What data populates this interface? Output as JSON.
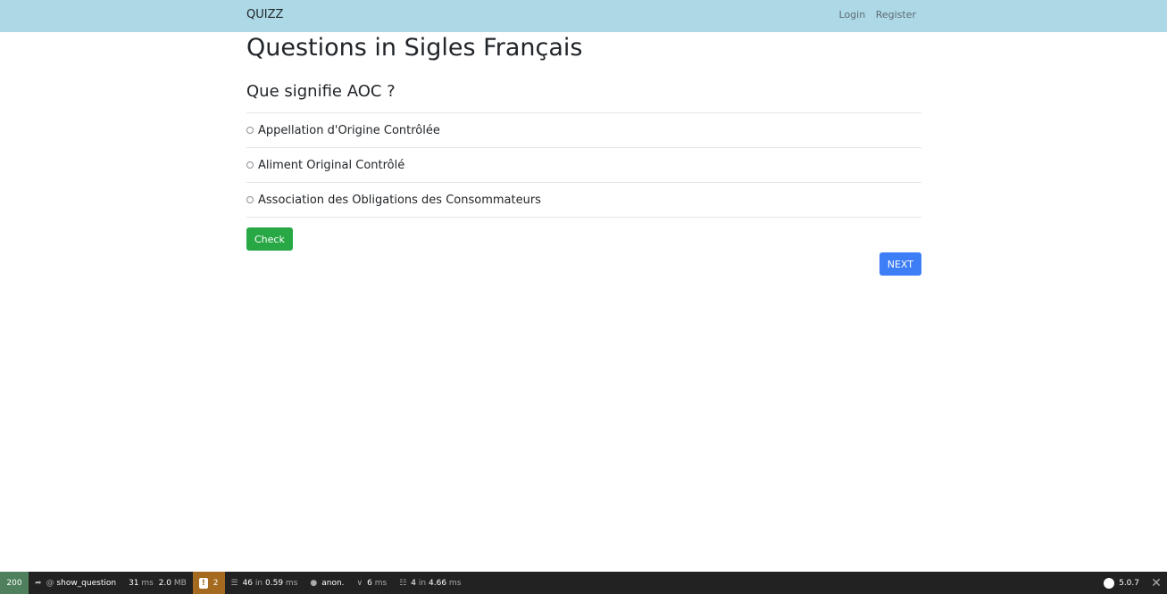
{
  "navbar": {
    "brand": "QUIZZ",
    "login": "Login",
    "register": "Register"
  },
  "page": {
    "title": "Questions in Sigles Français",
    "question": "Que signifie AOC ?",
    "answers": [
      "Appellation d'Origine Contrôlée",
      "Aliment Original Contrôlé",
      "Association des Obligations des Consommateurs"
    ],
    "check_label": "Check",
    "next_label": "NEXT"
  },
  "debug_toolbar": {
    "status_code": "200",
    "route": "show_question",
    "time": "31",
    "time_unit": "ms",
    "memory": "2.0",
    "memory_unit": "MB",
    "warnings": "2",
    "cache_count": "46",
    "cache_in": "in",
    "cache_time": "0.59",
    "cache_unit": "ms",
    "user": "anon.",
    "twig_time": "6",
    "twig_unit": "ms",
    "db_count": "4",
    "db_in": "in",
    "db_time": "4.66",
    "db_unit": "ms",
    "version": "5.0.7"
  },
  "colors": {
    "navbar_bg": "#add8e6",
    "check_button": "#28a745",
    "next_button": "#3d7df6",
    "toolbar_bg": "#222222",
    "status_ok": "#4f805d",
    "warning": "#a46a1f"
  }
}
